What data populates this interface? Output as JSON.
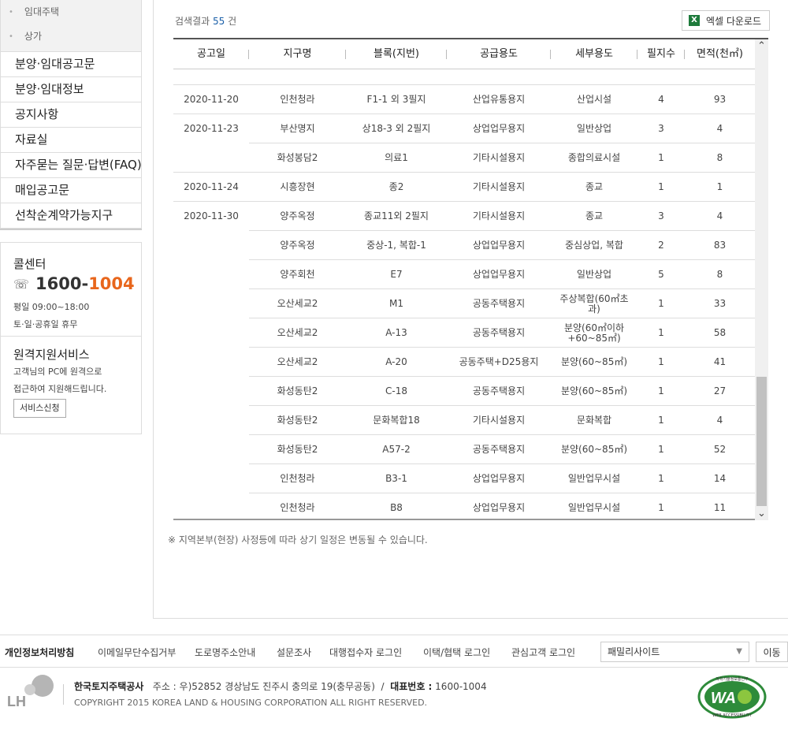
{
  "sidebar": {
    "submenu": [
      "임대주택",
      "상가"
    ],
    "menu": [
      "분양·임대공고문",
      "분양·임대정보",
      "공지사항",
      "자료실",
      "자주묻는 질문·답변(FAQ)",
      "매입공고문",
      "선착순계약가능지구"
    ]
  },
  "callcenter": {
    "title": "콜센터",
    "phone_prefix": "1600-",
    "phone_suffix": "1004",
    "hours": "평일 09:00~18:00",
    "holiday": "토·일·공휴일 휴무"
  },
  "remote": {
    "title": "원격지원서비스",
    "desc1": "고객님의 PC에 원격으로",
    "desc2": "접근하여 지원해드립니다.",
    "button": "서비스신청"
  },
  "results": {
    "prefix": "검색결과",
    "count": "55",
    "suffix": "건",
    "excel_label": "엑셀 다운로드",
    "excel_icon": "excel-icon"
  },
  "table": {
    "headers": [
      "공고일",
      "지구명",
      "블록(지번)",
      "공급용도",
      "세부용도",
      "필지수",
      "면적(천㎡)"
    ],
    "rows": [
      {
        "date": "2020-11-20",
        "district": "인천청라",
        "block": "F1-1 외 3필지",
        "supply": "산업유통용지",
        "detail": "산업시설",
        "lots": "4",
        "area": "93"
      },
      {
        "date": "2020-11-23",
        "district": "부산명지",
        "block": "상18-3 외 2필지",
        "supply": "상업업무용지",
        "detail": "일반상업",
        "lots": "3",
        "area": "4"
      },
      {
        "date": "",
        "district": "화성봉담2",
        "block": "의료1",
        "supply": "기타시설용지",
        "detail": "종합의료시설",
        "lots": "1",
        "area": "8"
      },
      {
        "date": "2020-11-24",
        "district": "시흥장현",
        "block": "종2",
        "supply": "기타시설용지",
        "detail": "종교",
        "lots": "1",
        "area": "1"
      },
      {
        "date": "2020-11-30",
        "district": "양주옥정",
        "block": "종교11외 2필지",
        "supply": "기타시설용지",
        "detail": "종교",
        "lots": "3",
        "area": "4"
      },
      {
        "date": "",
        "district": "양주옥정",
        "block": "중상-1, 복합-1",
        "supply": "상업업무용지",
        "detail": "중심상업, 복합",
        "lots": "2",
        "area": "83"
      },
      {
        "date": "",
        "district": "양주회천",
        "block": "E7",
        "supply": "상업업무용지",
        "detail": "일반상업",
        "lots": "5",
        "area": "8"
      },
      {
        "date": "",
        "district": "오산세교2",
        "block": "M1",
        "supply": "공동주택용지",
        "detail": "주상복합(60㎡초과)",
        "lots": "1",
        "area": "33"
      },
      {
        "date": "",
        "district": "오산세교2",
        "block": "A-13",
        "supply": "공동주택용지",
        "detail": "분양(60㎡이하+60~85㎡)",
        "lots": "1",
        "area": "58"
      },
      {
        "date": "",
        "district": "오산세교2",
        "block": "A-20",
        "supply": "공동주택+D25용지",
        "detail": "분양(60~85㎡)",
        "lots": "1",
        "area": "41"
      },
      {
        "date": "",
        "district": "화성동탄2",
        "block": "C-18",
        "supply": "공동주택용지",
        "detail": "분양(60~85㎡)",
        "lots": "1",
        "area": "27"
      },
      {
        "date": "",
        "district": "화성동탄2",
        "block": "문화복합18",
        "supply": "기타시설용지",
        "detail": "문화복합",
        "lots": "1",
        "area": "4"
      },
      {
        "date": "",
        "district": "화성동탄2",
        "block": "A57-2",
        "supply": "공동주택용지",
        "detail": "분양(60~85㎡)",
        "lots": "1",
        "area": "52"
      },
      {
        "date": "",
        "district": "인천청라",
        "block": "B3-1",
        "supply": "상업업무용지",
        "detail": "일반업무시설",
        "lots": "1",
        "area": "14"
      },
      {
        "date": "",
        "district": "인천청라",
        "block": "B8",
        "supply": "상업업무용지",
        "detail": "일반업무시설",
        "lots": "1",
        "area": "11"
      }
    ]
  },
  "note": "※ 지역본부(현장) 사정등에 따라 상기 일정은 변동될 수 있습니다.",
  "footer": {
    "links": [
      "개인정보처리방침",
      "이메일무단수집거부",
      "도로명주소안내",
      "설문조사",
      "대행접수자 로그인",
      "이택/협택 로그인",
      "관심고객 로그인"
    ],
    "family_site": "패밀리사이트",
    "go_button": "이동",
    "company": "한국토지주택공사",
    "address": "주소 : 우)52852 경상남도 진주시 충의로 19(충무공동)",
    "rep_label": "대표번호 :",
    "rep_phone": "1600-1004",
    "copyright": "COPYRIGHT 2015 KOREA LAND & HOUSING CORPORATION ALL RIGHT RESERVED.",
    "logo_text": "LH",
    "wa_mark_text": "WA",
    "wa_mark_sub": "WEB ACCESSIBILITY",
    "wa_mark_top": "과학기술정보통신부"
  }
}
